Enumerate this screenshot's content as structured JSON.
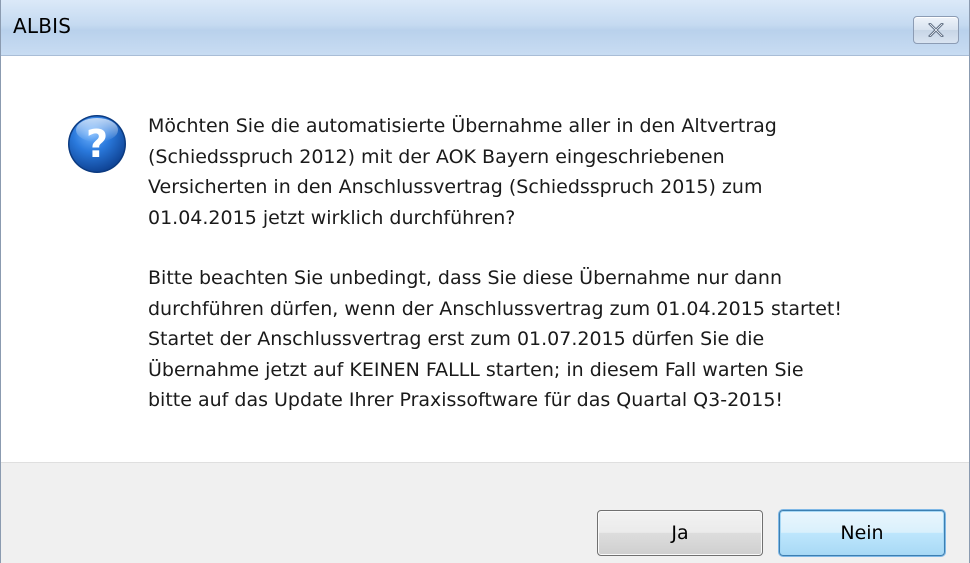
{
  "window": {
    "title": "ALBIS"
  },
  "dialog": {
    "icon": "question-icon",
    "paragraphs": [
      "Möchten Sie die automatisierte Übernahme aller in den Altvertrag\n(Schiedsspruch 2012) mit der AOK Bayern eingeschriebenen\nVersicherten in den Anschlussvertrag (Schiedsspruch 2015) zum\n01.04.2015 jetzt wirklich durchführen?",
      "Bitte beachten Sie unbedingt, dass Sie diese Übernahme nur dann\ndurchführen dürfen, wenn der Anschlussvertrag zum 01.04.2015 startet!\nStartet der Anschlussvertrag erst zum 01.07.2015 dürfen Sie die\nÜbernahme jetzt auf KEINEN FALLL starten; in diesem Fall warten Sie\nbitte auf das Update Ihrer Praxissoftware für das Quartal Q3-2015!"
    ]
  },
  "buttons": {
    "yes_mnemonic": "J",
    "yes_rest": "a",
    "no_label": "Nein"
  },
  "colors": {
    "titlebar": "#c5daf1",
    "icon_blue": "#1d5fb8",
    "default_button_border": "#3c7fb1",
    "button_bar": "#f0f0f0"
  }
}
